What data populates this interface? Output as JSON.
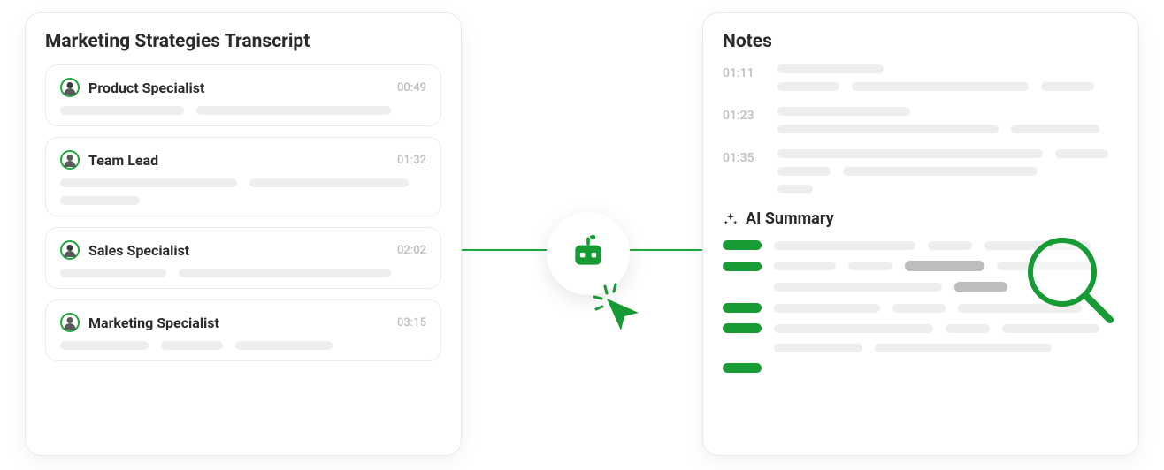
{
  "colors": {
    "accent": "#1ea83c",
    "text": "#2b2b2b",
    "muted": "#bfbfbf",
    "skeleton": "#eeeeee"
  },
  "transcript": {
    "title": "Marketing Strategies Transcript",
    "entries": [
      {
        "speaker": "Product Specialist",
        "timestamp": "00:49",
        "avatar": "female"
      },
      {
        "speaker": "Team Lead",
        "timestamp": "01:32",
        "avatar": "male"
      },
      {
        "speaker": "Sales Specialist",
        "timestamp": "02:02",
        "avatar": "female"
      },
      {
        "speaker": "Marketing Specialist",
        "timestamp": "03:15",
        "avatar": "male"
      }
    ]
  },
  "notes": {
    "title": "Notes",
    "items": [
      {
        "timestamp": "01:11"
      },
      {
        "timestamp": "01:23"
      },
      {
        "timestamp": "01:35"
      }
    ],
    "ai_summary_title": "AI Summary"
  },
  "center": {
    "icon": "robot-icon",
    "cursor_icon": "cursor-click-icon"
  }
}
